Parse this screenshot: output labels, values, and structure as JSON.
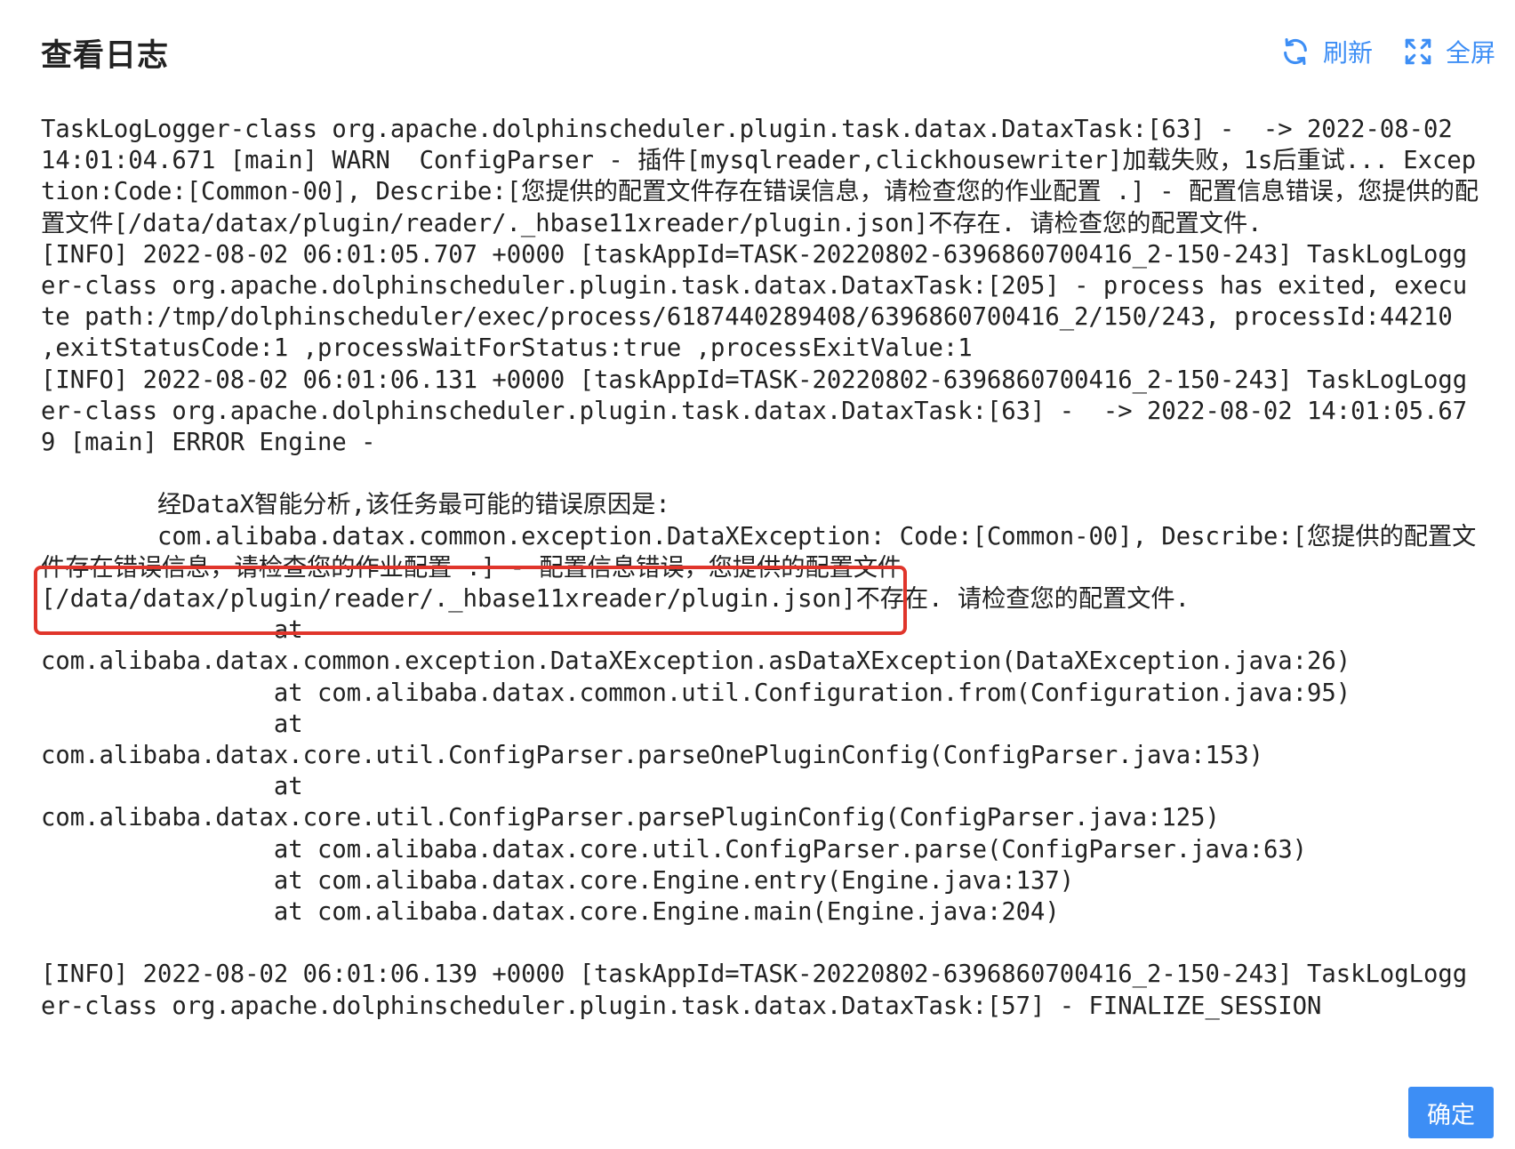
{
  "dialog": {
    "title": "查看日志",
    "actions": {
      "refresh_label": "刷新",
      "fullscreen_label": "全屏"
    },
    "confirm_label": "确定",
    "accent_color": "#3d8ef5",
    "highlight_color": "#e0352b"
  },
  "log": {
    "text": "TaskLogLogger-class org.apache.dolphinscheduler.plugin.task.datax.DataxTask:[63] -  -> 2022-08-02 14:01:04.671 [main] WARN  ConfigParser - 插件[mysqlreader,clickhousewriter]加载失败，1s后重试... Exception:Code:[Common-00], Describe:[您提供的配置文件存在错误信息，请检查您的作业配置 .] - 配置信息错误，您提供的配置文件[/data/datax/plugin/reader/._hbase11xreader/plugin.json]不存在. 请检查您的配置文件.\n[INFO] 2022-08-02 06:01:05.707 +0000 [taskAppId=TASK-20220802-6396860700416_2-150-243] TaskLogLogger-class org.apache.dolphinscheduler.plugin.task.datax.DataxTask:[205] - process has exited, execute path:/tmp/dolphinscheduler/exec/process/6187440289408/6396860700416_2/150/243, processId:44210 ,exitStatusCode:1 ,processWaitForStatus:true ,processExitValue:1\n[INFO] 2022-08-02 06:01:06.131 +0000 [taskAppId=TASK-20220802-6396860700416_2-150-243] TaskLogLogger-class org.apache.dolphinscheduler.plugin.task.datax.DataxTask:[63] -  -> 2022-08-02 14:01:05.679 [main] ERROR Engine -\n\n        经DataX智能分析,该任务最可能的错误原因是:\n        com.alibaba.datax.common.exception.DataXException: Code:[Common-00], Describe:[您提供的配置文件存在错误信息，请检查您的作业配置 .] - 配置信息错误，您提供的配置文件\n[/data/datax/plugin/reader/._hbase11xreader/plugin.json]不存在. 请检查您的配置文件.\n                at\ncom.alibaba.datax.common.exception.DataXException.asDataXException(DataXException.java:26)\n                at com.alibaba.datax.common.util.Configuration.from(Configuration.java:95)\n                at\ncom.alibaba.datax.core.util.ConfigParser.parseOnePluginConfig(ConfigParser.java:153)\n                at\ncom.alibaba.datax.core.util.ConfigParser.parsePluginConfig(ConfigParser.java:125)\n                at com.alibaba.datax.core.util.ConfigParser.parse(ConfigParser.java:63)\n                at com.alibaba.datax.core.Engine.entry(Engine.java:137)\n                at com.alibaba.datax.core.Engine.main(Engine.java:204)\n\n[INFO] 2022-08-02 06:01:06.139 +0000 [taskAppId=TASK-20220802-6396860700416_2-150-243] TaskLogLogger-class org.apache.dolphinscheduler.plugin.task.datax.DataxTask:[57] - FINALIZE_SESSION"
  },
  "icons": {
    "refresh": "refresh-icon",
    "fullscreen": "fullscreen-icon"
  }
}
